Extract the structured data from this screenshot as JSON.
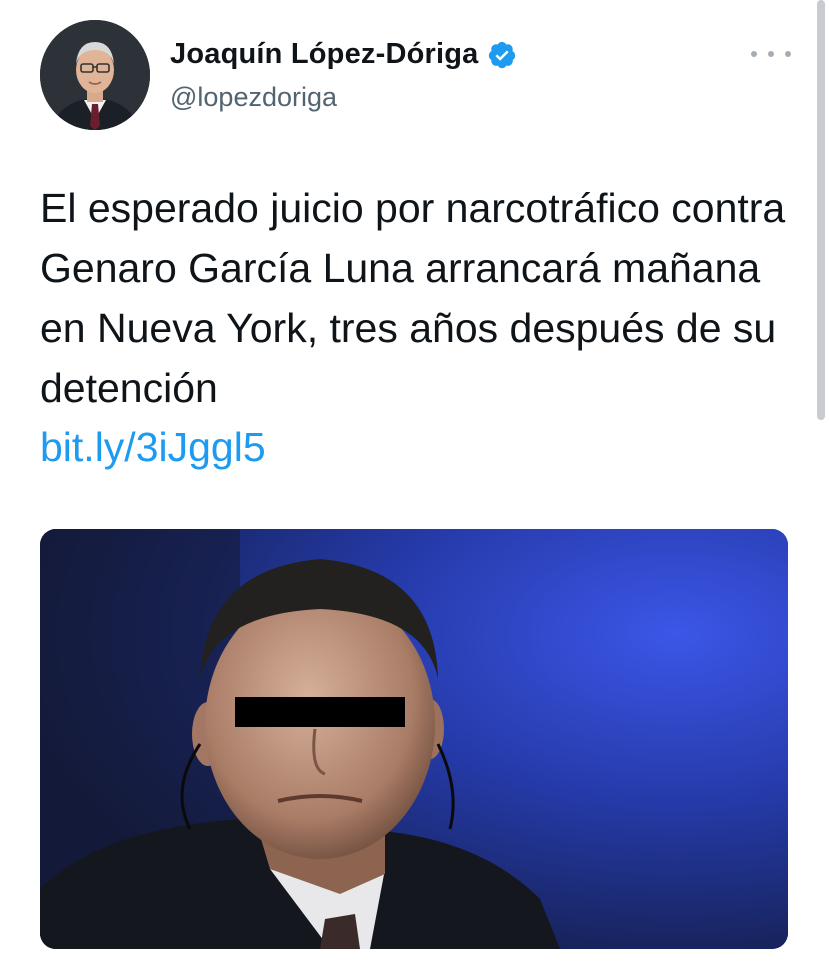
{
  "tweet": {
    "author": {
      "display_name": "Joaquín López-Dóriga",
      "handle": "@lopezdoriga",
      "verified": true,
      "verified_icon": "verified-badge-icon"
    },
    "text": "El esperado juicio por narcotráfico contra Genaro García Luna arrancará mañana en Nueva York, tres años después de su detención",
    "link": "bit.ly/3iJggl5",
    "more_icon": "more-dots-icon",
    "media": {
      "description_icon": "photo"
    }
  },
  "colors": {
    "link": "#1d9bf0",
    "verified": "#1d9bf0",
    "text": "#0f1419",
    "secondary": "#536471",
    "media_bg": "#1c2a70"
  }
}
